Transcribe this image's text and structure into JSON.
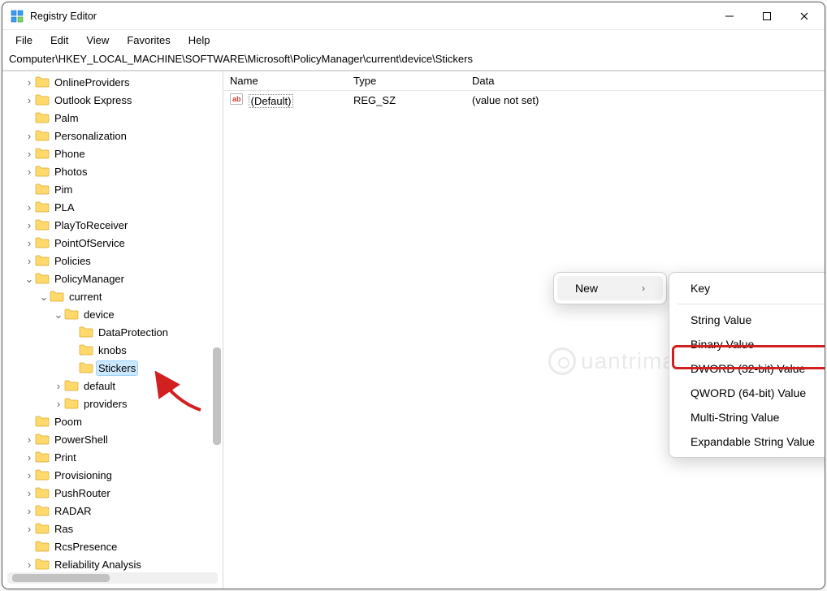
{
  "titlebar": {
    "title": "Registry Editor"
  },
  "menu": {
    "file": "File",
    "edit": "Edit",
    "view": "View",
    "favorites": "Favorites",
    "help": "Help"
  },
  "address": "Computer\\HKEY_LOCAL_MACHINE\\SOFTWARE\\Microsoft\\PolicyManager\\current\\device\\Stickers",
  "tree": [
    {
      "depth": 1,
      "expand": ">",
      "label": "OnlineProviders"
    },
    {
      "depth": 1,
      "expand": ">",
      "label": "Outlook Express"
    },
    {
      "depth": 1,
      "expand": "",
      "label": "Palm"
    },
    {
      "depth": 1,
      "expand": ">",
      "label": "Personalization"
    },
    {
      "depth": 1,
      "expand": ">",
      "label": "Phone"
    },
    {
      "depth": 1,
      "expand": ">",
      "label": "Photos"
    },
    {
      "depth": 1,
      "expand": "",
      "label": "Pim"
    },
    {
      "depth": 1,
      "expand": ">",
      "label": "PLA"
    },
    {
      "depth": 1,
      "expand": ">",
      "label": "PlayToReceiver"
    },
    {
      "depth": 1,
      "expand": ">",
      "label": "PointOfService"
    },
    {
      "depth": 1,
      "expand": ">",
      "label": "Policies"
    },
    {
      "depth": 1,
      "expand": "v",
      "label": "PolicyManager"
    },
    {
      "depth": 2,
      "expand": "v",
      "label": "current"
    },
    {
      "depth": 3,
      "expand": "v",
      "label": "device"
    },
    {
      "depth": 4,
      "expand": "",
      "label": "DataProtection"
    },
    {
      "depth": 4,
      "expand": "",
      "label": "knobs"
    },
    {
      "depth": 4,
      "expand": "",
      "label": "Stickers",
      "selected": true
    },
    {
      "depth": 3,
      "expand": ">",
      "label": "default"
    },
    {
      "depth": 3,
      "expand": ">",
      "label": "providers"
    },
    {
      "depth": 1,
      "expand": "",
      "label": "Poom"
    },
    {
      "depth": 1,
      "expand": ">",
      "label": "PowerShell"
    },
    {
      "depth": 1,
      "expand": ">",
      "label": "Print"
    },
    {
      "depth": 1,
      "expand": ">",
      "label": "Provisioning"
    },
    {
      "depth": 1,
      "expand": ">",
      "label": "PushRouter"
    },
    {
      "depth": 1,
      "expand": ">",
      "label": "RADAR"
    },
    {
      "depth": 1,
      "expand": ">",
      "label": "Ras"
    },
    {
      "depth": 1,
      "expand": "",
      "label": "RcsPresence"
    },
    {
      "depth": 1,
      "expand": ">",
      "label": "Reliability Analysis"
    }
  ],
  "list": {
    "headers": {
      "name": "Name",
      "type": "Type",
      "data": "Data"
    },
    "rows": [
      {
        "name": "(Default)",
        "type": "REG_SZ",
        "data": "(value not set)"
      }
    ]
  },
  "ctx_new": {
    "new": "New"
  },
  "ctx_sub": {
    "key": "Key",
    "string": "String Value",
    "binary": "Binary Value",
    "dword": "DWORD (32-bit) Value",
    "qword": "QWORD (64-bit) Value",
    "multi": "Multi-String Value",
    "expand": "Expandable String Value"
  },
  "watermark": "uantrima"
}
